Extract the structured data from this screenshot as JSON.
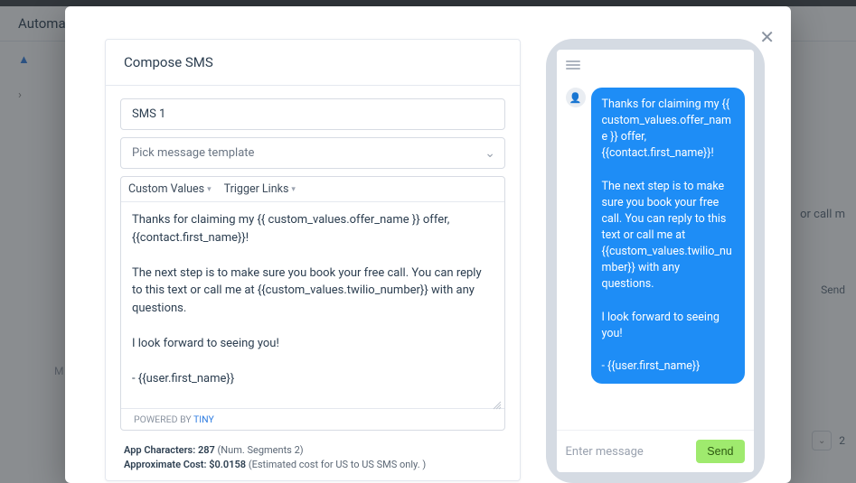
{
  "bg": {
    "page_title": "Automa",
    "right_hint": "or call m",
    "send_label": "Send",
    "bottom_num": "2",
    "m_label": "M"
  },
  "modal": {
    "close_glyph": "✕"
  },
  "compose": {
    "title": "Compose SMS",
    "name_value": "SMS 1",
    "template_placeholder": "Pick message template",
    "toolbar": {
      "custom_values": "Custom Values",
      "trigger_links": "Trigger Links"
    },
    "body": "Thanks for claiming my {{ custom_values.offer_name }} offer, {{contact.first_name}}!\n\nThe next step is to make sure you book your free call. You can reply to this text or call me at {{custom_values.twilio_number}} with any questions.\n\nI look forward to seeing you!\n\n- {{user.first_name}}",
    "powered_by": "POWERED BY",
    "tiny": "TINY",
    "stats": {
      "chars_label": "App Characters:",
      "chars_value": "287",
      "segments": "(Num. Segments 2)",
      "cost_label": "Approximate Cost:",
      "cost_value": "$0.0158",
      "cost_note": "(Estimated cost for US to US SMS only. )"
    }
  },
  "phone": {
    "avatar_emoji": "👤",
    "bubble_text": "Thanks for claiming my {{ custom_values.offer_name }} offer, {{contact.first_name}}!\n\nThe next step is to make sure you book your free call. You can reply to this text or call me at {{custom_values.twilio_number}} with any questions.\n\nI look forward to seeing you!\n\n- {{user.first_name}}",
    "input_placeholder": "Enter message",
    "send_label": "Send"
  }
}
